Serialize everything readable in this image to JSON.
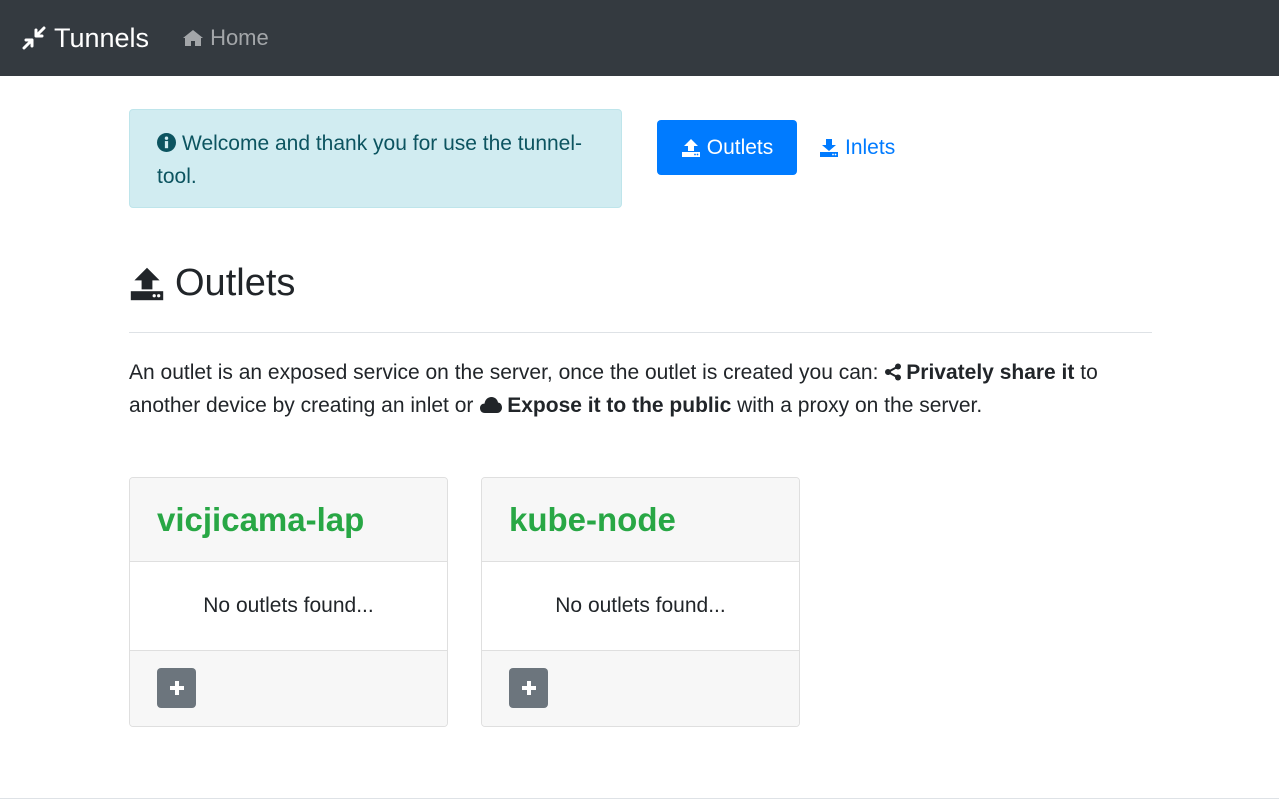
{
  "navbar": {
    "brand": "Tunnels",
    "brand_icon": "compress-arrows-icon",
    "home_label": "Home",
    "home_icon": "home-icon",
    "background": "#343a40"
  },
  "alert": {
    "icon": "info-circle-icon",
    "text": "Welcome and thank you for use the tunnel-tool."
  },
  "buttons": {
    "outlets_label": "Outlets",
    "inlets_label": "Inlets",
    "accent": "#007bff"
  },
  "section": {
    "title": "Outlets",
    "description": {
      "part1": "An outlet is an exposed service on the server, once the outlet is created you can:",
      "share_label": "Privately share it",
      "part2": "to another device by creating an inlet or",
      "expose_label": "Expose it to the public",
      "part3": "with a proxy on the server."
    }
  },
  "cards": [
    {
      "name": "vicjicama-lap",
      "empty_text": "No outlets found..."
    },
    {
      "name": "kube-node",
      "empty_text": "No outlets found..."
    }
  ],
  "colors": {
    "node_name": "#28a745",
    "add_button": "#6c757d",
    "alert_bg": "#d1ecf1"
  }
}
